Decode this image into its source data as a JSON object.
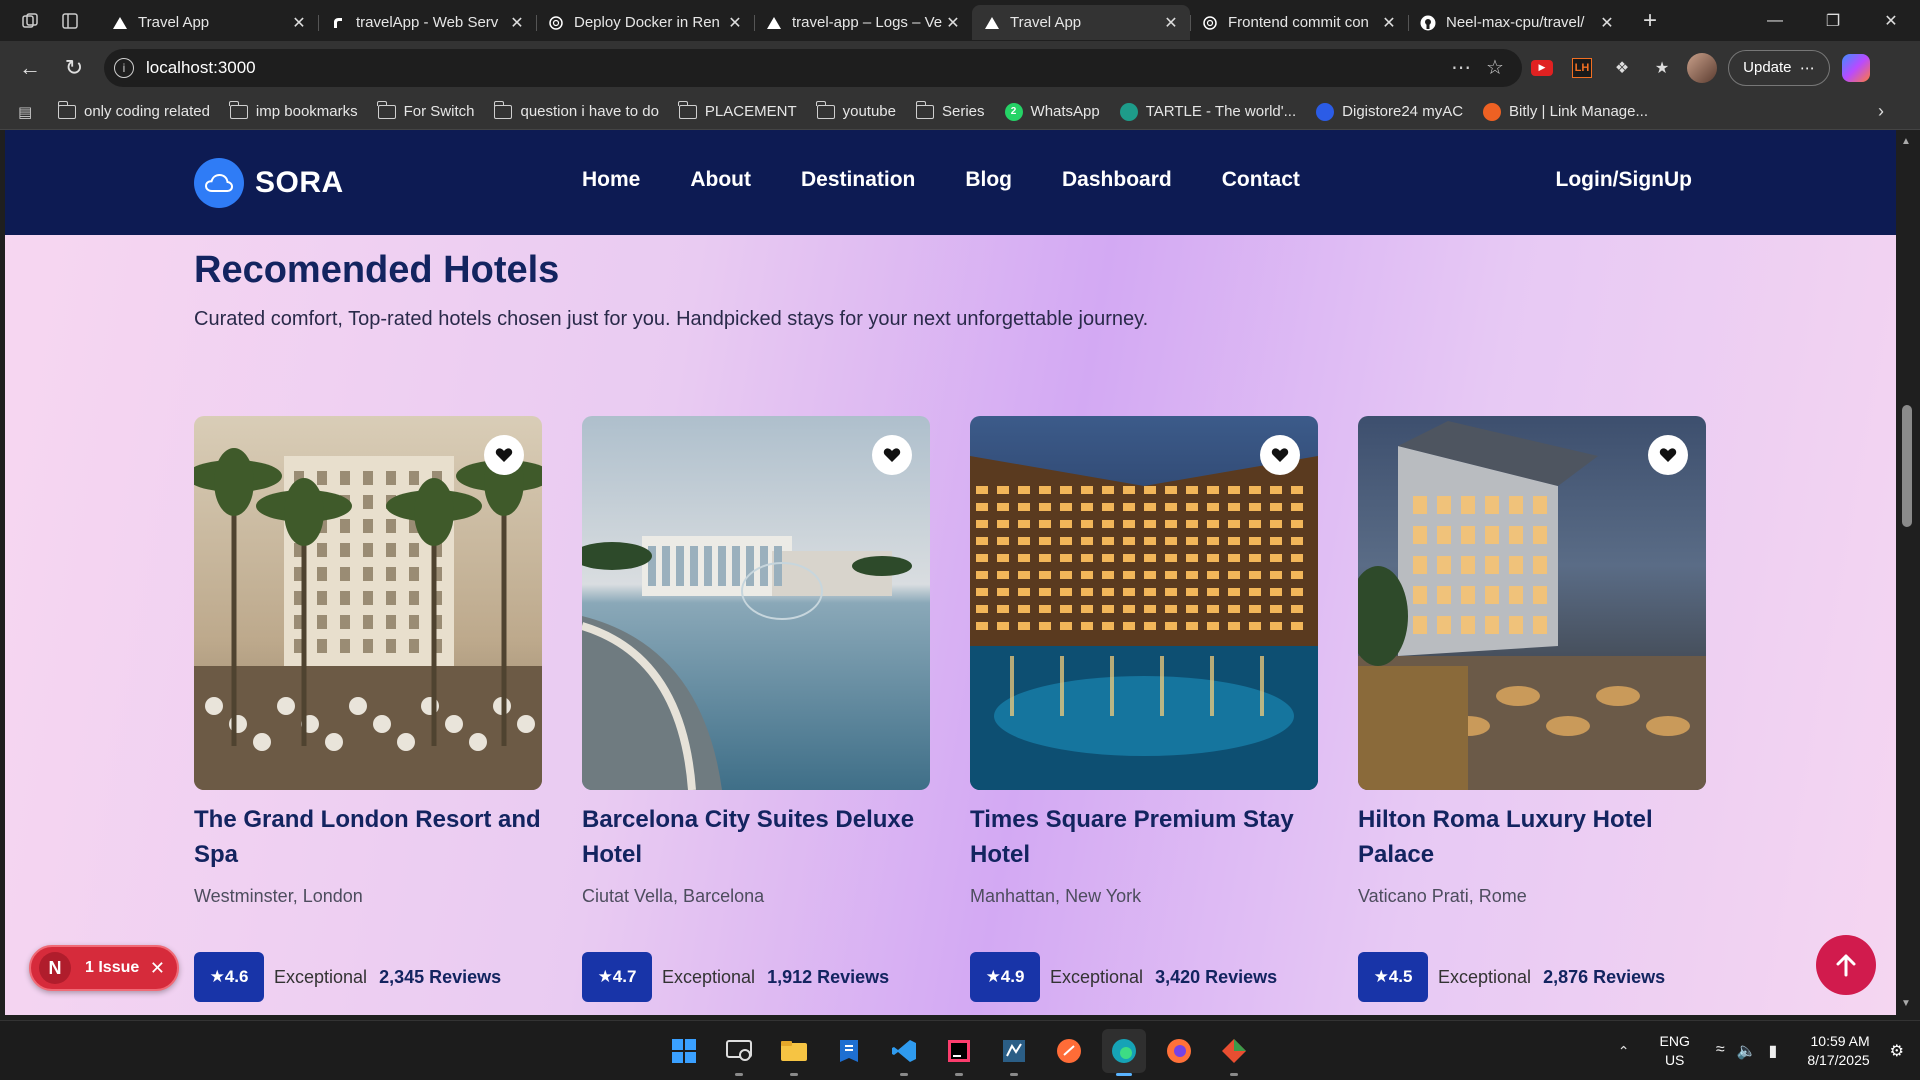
{
  "browser": {
    "tabs": [
      {
        "title": "Travel App",
        "favicon": "vercel-triangle-icon",
        "active": false
      },
      {
        "title": "travelApp - Web Serv",
        "favicon": "render-icon",
        "active": false
      },
      {
        "title": "Deploy Docker in Ren",
        "favicon": "chatgpt-icon",
        "active": false
      },
      {
        "title": "travel-app – Logs – Ve",
        "favicon": "vercel-triangle-icon",
        "active": false
      },
      {
        "title": "Travel App",
        "favicon": "vercel-triangle-icon",
        "active": true
      },
      {
        "title": "Frontend commit con",
        "favicon": "chatgpt-icon",
        "active": false
      },
      {
        "title": "Neel-max-cpu/travel/",
        "favicon": "github-icon",
        "active": false
      }
    ],
    "url": "localhost:3000",
    "update_label": "Update",
    "bookmarks": [
      {
        "label": "only coding  related",
        "icon": "folder-icon"
      },
      {
        "label": "imp bookmarks",
        "icon": "folder-icon"
      },
      {
        "label": "For Switch",
        "icon": "folder-icon"
      },
      {
        "label": "question i have to do",
        "icon": "folder-icon"
      },
      {
        "label": "PLACEMENT",
        "icon": "folder-icon"
      },
      {
        "label": "youtube",
        "icon": "folder-icon"
      },
      {
        "label": "Series",
        "icon": "folder-icon"
      },
      {
        "label": "WhatsApp",
        "icon": "whatsapp-icon",
        "badge": "2"
      },
      {
        "label": "TARTLE - The world'...",
        "icon": "tartle-icon"
      },
      {
        "label": "Digistore24 myAC",
        "icon": "digistore-icon"
      },
      {
        "label": "Bitly | Link Manage...",
        "icon": "bitly-icon"
      }
    ]
  },
  "site": {
    "brand": "SORA",
    "nav": [
      "Home",
      "About",
      "Destination",
      "Blog",
      "Dashboard",
      "Contact"
    ],
    "login": "Login/SignUp",
    "section": {
      "title": "Recomended Hotels",
      "subtitle": "Curated comfort, Top-rated hotels chosen just for you. Handpicked stays for your next unforgettable journey."
    },
    "hotels": [
      {
        "name": "The Grand London Resort and Spa",
        "location": "Westminster, London",
        "rating": "★4.6",
        "label": "Exceptional",
        "reviews": "2,345 Reviews"
      },
      {
        "name": "Barcelona City Suites Deluxe Hotel",
        "location": "Ciutat Vella, Barcelona",
        "rating": "★4.7",
        "label": "Exceptional",
        "reviews": "1,912 Reviews"
      },
      {
        "name": "Times Square Premium Stay Hotel",
        "location": "Manhattan, New York",
        "rating": "★4.9",
        "label": "Exceptional",
        "reviews": "3,420 Reviews"
      },
      {
        "name": "Hilton Roma Luxury Hotel Palace",
        "location": "Vaticano Prati, Rome",
        "rating": "★4.5",
        "label": "Exceptional",
        "reviews": "2,876 Reviews"
      }
    ],
    "issue_badge": {
      "letter": "N",
      "text": "1 Issue"
    }
  },
  "taskbar": {
    "apps": [
      "windows-start-icon",
      "remote-desktop-icon",
      "file-explorer-icon",
      "azure-data-studio-icon",
      "vscode-icon",
      "intellij-icon",
      "mysql-workbench-icon",
      "postman-icon",
      "edge-icon",
      "firefox-icon",
      "git-tool-icon"
    ],
    "lang_top": "ENG",
    "lang_bottom": "US",
    "time": "10:59 AM",
    "date": "8/17/2025"
  },
  "colors": {
    "nav_bg": "#0d1b53",
    "title": "#132460",
    "rating_badge": "#1834a8",
    "scroll_top": "#d11b4d",
    "issue_pill": "#d62b3b",
    "logo_badge": "#2f7cf6"
  }
}
